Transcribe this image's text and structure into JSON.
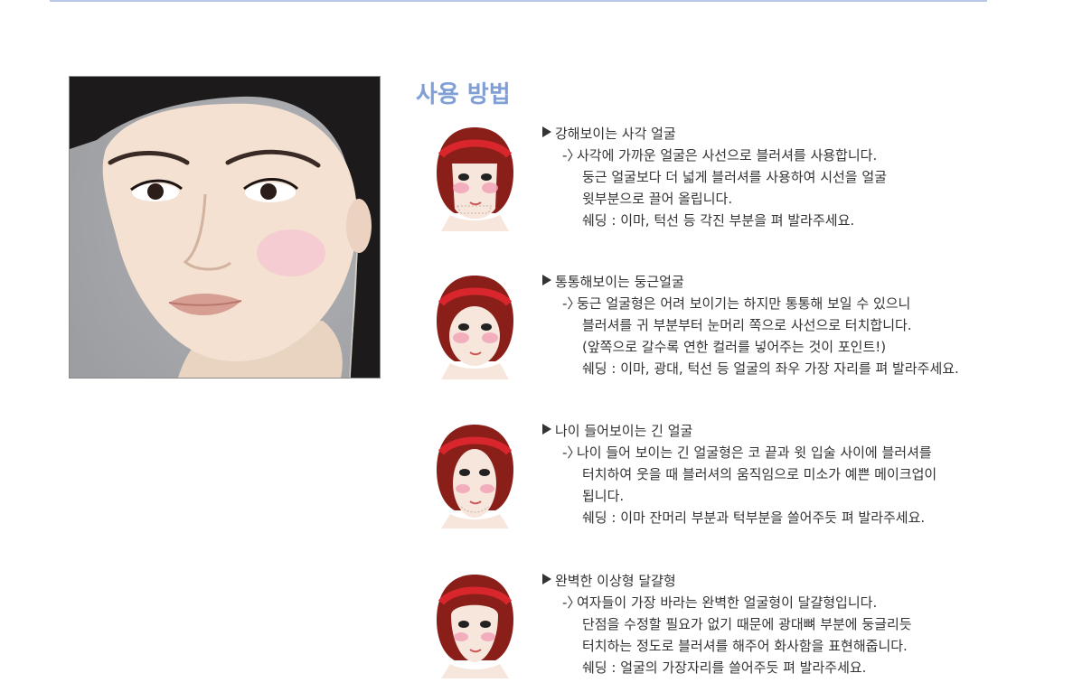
{
  "section": {
    "title": "사용 방법"
  },
  "face_types": [
    {
      "heading": "강해보이는 사각 얼굴",
      "arrow": "-〉",
      "lines": [
        "사각에 가까운 얼굴은 사선으로 블러셔를 사용합니다.",
        "둥근 얼굴보다 더 넓게 블러셔를 사용하여 시선을 얼굴",
        "윗부분으로 끌어 올립니다.",
        "쉐딩 : 이마, 턱선 등 각진 부분을 펴 발라주세요."
      ]
    },
    {
      "heading": "통통해보이는 둥근얼굴",
      "arrow": "-〉",
      "lines": [
        "둥근 얼굴형은 어려 보이기는 하지만 통통해 보일 수 있으니",
        "블러셔를 귀 부분부터 눈머리 쪽으로 사선으로 터치합니다.",
        "(앞쪽으로 갈수록 연한 컬러를 넣어주는 것이 포인트!)",
        "쉐딩 : 이마, 광대, 턱선 등 얼굴의 좌우 가장 자리를 펴 발라주세요."
      ]
    },
    {
      "heading": "나이 들어보이는 긴 얼굴",
      "arrow": "-〉",
      "lines": [
        "나이 들어 보이는 긴 얼굴형은 코 끝과 윗 입술 사이에 블러셔를",
        "터치하여 웃을 때 블러셔의 움직임으로 미소가 예쁜 메이크업이",
        "됩니다.",
        "쉐딩 : 이마 잔머리 부분과 턱부분을 쓸어주듯 펴 발라주세요."
      ]
    },
    {
      "heading": "완벽한 이상형 달걀형",
      "arrow": "-〉",
      "lines": [
        "여자들이 가장 바라는 완벽한 얼굴형이 달걀형입니다.",
        "단점을 수정할 필요가 없기 때문에 광대뼈 부분에 둥글리듯",
        "터치하는 정도로 블러셔를 해주어 화사함을 표현해줍니다.",
        "쉐딩 : 얼굴의 가장자리를 쓸어주듯 펴 발라주세요."
      ]
    }
  ],
  "colors": {
    "title": "#7f9fd6",
    "rule": "#b9c7e6",
    "hair": "#8a1f1a",
    "headband": "#d8262c",
    "blush": "#f2a3b8"
  }
}
